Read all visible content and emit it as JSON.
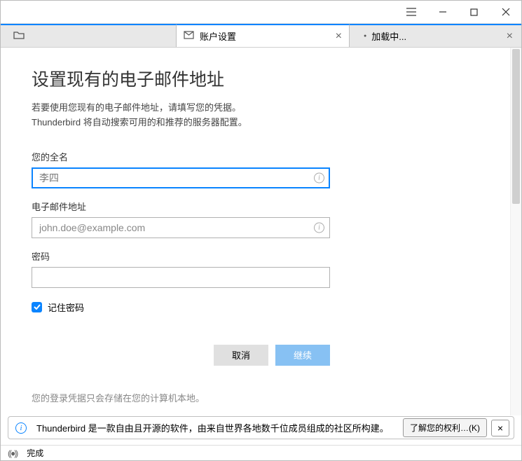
{
  "titlebar": {},
  "tabs": {
    "active_label": "账户设置",
    "loading_label": "加载中..."
  },
  "page": {
    "heading": "设置现有的电子邮件地址",
    "sub1": "若要使用您现有的电子邮件地址，请填写您的凭据。",
    "sub2": "Thunderbird 将自动搜索可用的和推荐的服务器配置。",
    "fullname_label": "您的全名",
    "fullname_value": "李四",
    "email_label": "电子邮件地址",
    "email_placeholder": "john.doe@example.com",
    "password_label": "密码",
    "remember_label": "记住密码",
    "cancel": "取消",
    "continue": "继续",
    "footnote": "您的登录凭据只会存储在您的计算机本地。"
  },
  "notification": {
    "text": "Thunderbird 是一款自由且开源的软件，由来自世界各地数千位成员组成的社区所构建。",
    "button": "了解您的权利…(K)"
  },
  "status": {
    "text": "完成"
  }
}
